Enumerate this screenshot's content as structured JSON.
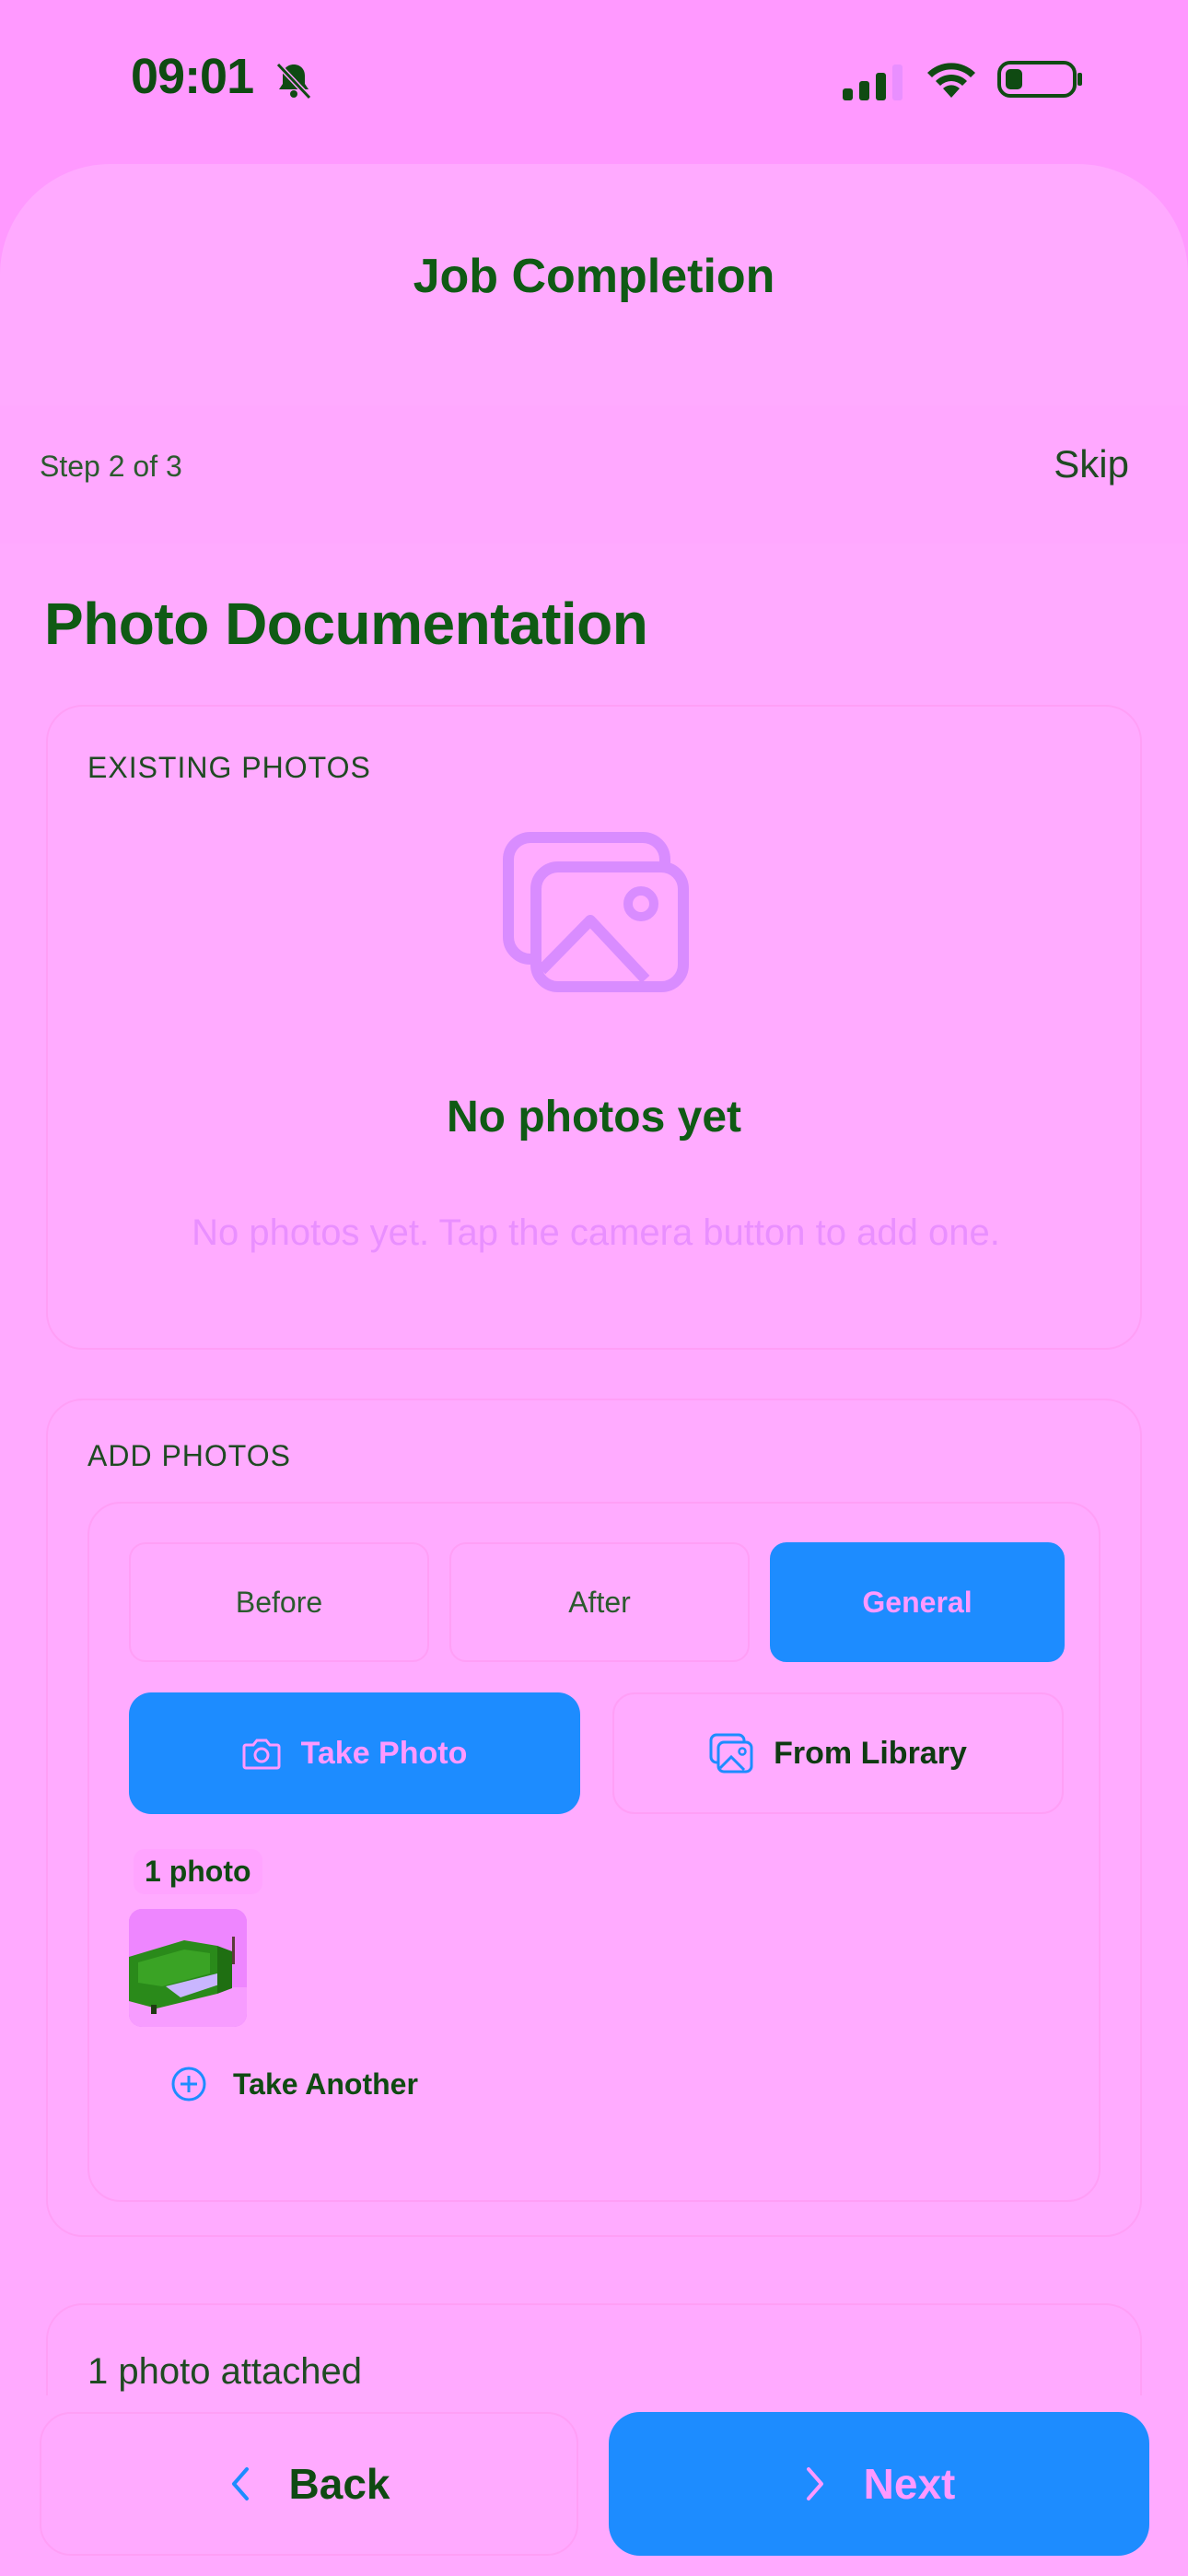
{
  "status_bar": {
    "time": "09:01",
    "icons": [
      "bell-slash-icon",
      "cellular-signal-icon",
      "wifi-icon",
      "battery-icon"
    ]
  },
  "header": {
    "title": "Job Completion",
    "step": "Step 2 of 3",
    "skip_label": "Skip"
  },
  "page": {
    "heading": "Photo Documentation"
  },
  "existing_photos": {
    "label": "EXISTING PHOTOS",
    "icon": "image-stack-icon",
    "empty_title": "No photos yet",
    "empty_description": "No photos yet. Tap the camera button to add one."
  },
  "add_photos": {
    "label": "ADD PHOTOS",
    "categories": [
      {
        "label": "Before",
        "active": false
      },
      {
        "label": "After",
        "active": false
      },
      {
        "label": "General",
        "active": true
      }
    ],
    "take_photo_label": "Take Photo",
    "from_library_label": "From Library",
    "photo_count": "1 photo",
    "take_another_label": "Take Another"
  },
  "summary": {
    "attached_text": "1 photo attached"
  },
  "footer": {
    "back_label": "Back",
    "next_label": "Next"
  },
  "colors": {
    "background": "#ff99ff",
    "primary": "#1d8cff",
    "text": "#0f5a14",
    "muted": "#e98fff"
  }
}
